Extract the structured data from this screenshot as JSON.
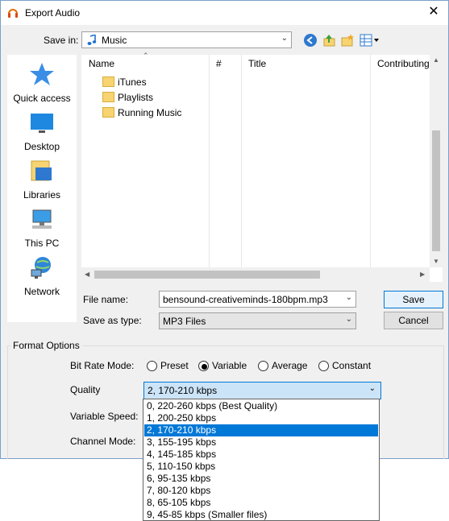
{
  "window": {
    "title": "Export Audio",
    "close_glyph": "✕"
  },
  "save_in": {
    "label": "Save in:",
    "value": "Music"
  },
  "places": [
    {
      "label": "Quick access",
      "icon": "star-icon"
    },
    {
      "label": "Desktop",
      "icon": "desktop-icon"
    },
    {
      "label": "Libraries",
      "icon": "libraries-icon"
    },
    {
      "label": "This PC",
      "icon": "computer-icon"
    },
    {
      "label": "Network",
      "icon": "network-icon"
    }
  ],
  "file_list": {
    "columns": [
      "Name",
      "#",
      "Title",
      "Contributing"
    ],
    "items": [
      "iTunes",
      "Playlists",
      "Running Music"
    ]
  },
  "file_name": {
    "label": "File name:",
    "value": "bensound-creativeminds-180bpm.mp3"
  },
  "save_as_type": {
    "label": "Save as type:",
    "value": "MP3 Files"
  },
  "buttons": {
    "save": "Save",
    "cancel": "Cancel"
  },
  "format_options": {
    "title": "Format Options",
    "bit_rate_label": "Bit Rate Mode:",
    "modes": [
      "Preset",
      "Variable",
      "Average",
      "Constant"
    ],
    "selected_mode": "Variable",
    "quality_label": "Quality",
    "quality_value": "2, 170-210 kbps",
    "variable_speed_label": "Variable Speed:",
    "channel_mode_label": "Channel Mode:"
  },
  "quality_options": [
    "0, 220-260 kbps (Best Quality)",
    "1, 200-250 kbps",
    "2, 170-210 kbps",
    "3, 155-195 kbps",
    "4, 145-185 kbps",
    "5, 110-150 kbps",
    "6, 95-135 kbps",
    "7, 80-120 kbps",
    "8, 65-105 kbps",
    "9, 45-85 kbps (Smaller files)"
  ],
  "selected_quality_index": 2,
  "colors": {
    "accent": "#0078d7",
    "selection_bg": "#cce4f7",
    "folder": "#f7d471"
  }
}
